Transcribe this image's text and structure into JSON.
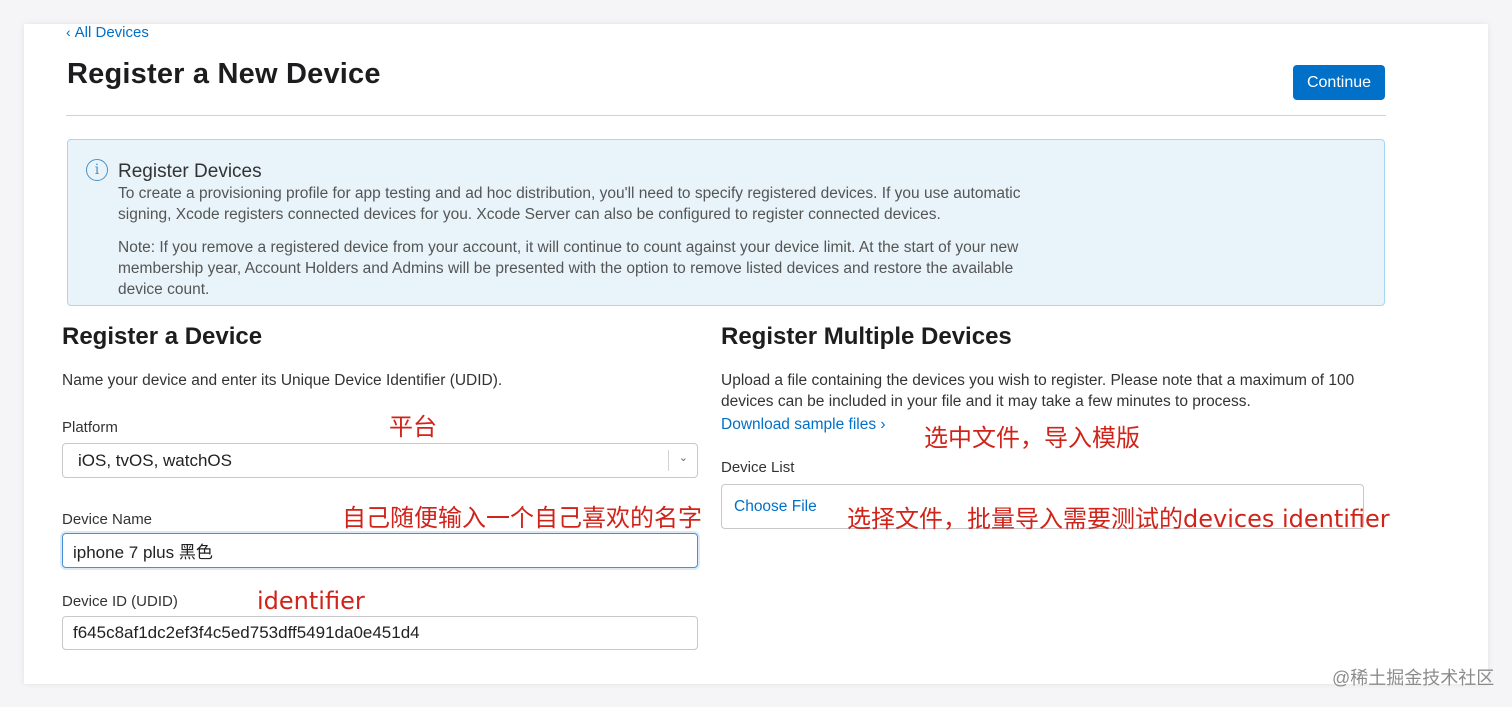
{
  "nav": {
    "back_chevron": "‹",
    "back_label": "All Devices"
  },
  "header": {
    "title": "Register a New Device",
    "continue_label": "Continue"
  },
  "info": {
    "icon": "info-icon",
    "icon_glyph": "i",
    "title": "Register Devices",
    "paragraph1": "To create a provisioning profile for app testing and ad hoc distribution, you'll need to specify registered devices. If you use automatic signing, Xcode registers connected devices for you. Xcode Server can also be configured to register connected devices.",
    "paragraph2": "Note: If you remove a registered device from your account, it will continue to count against your device limit. At the start of your new membership year, Account Holders and Admins will be presented with the option to remove listed devices and restore the available device count."
  },
  "single": {
    "title": "Register a Device",
    "description": "Name your device and enter its Unique Device Identifier (UDID).",
    "platform_label": "Platform",
    "platform_value": "iOS, tvOS, watchOS",
    "name_label": "Device Name",
    "name_value": "iphone 7 plus 黑色",
    "udid_label": "Device ID (UDID)",
    "udid_value": "f645c8af1dc2ef3f4c5ed753dff5491da0e451d4"
  },
  "multiple": {
    "title": "Register Multiple Devices",
    "description": "Upload a file containing the devices you wish to register. Please note that a maximum of 100 devices can be included in your file and it may take a few minutes to process.",
    "download_label": "Download sample files ›",
    "list_label": "Device List",
    "choose_file_label": "Choose File"
  },
  "annotations": {
    "platform": "平台",
    "name": "自己随便输入一个自己喜欢的名字",
    "identifier": "identifier",
    "template": "选中文件，导入模版",
    "batch": "选择文件，批量导入需要测试的devices  identifier"
  },
  "watermark": "@稀土掘金技术社区",
  "colors": {
    "accent": "#0070c9",
    "annotation": "#d0241b",
    "info_bg": "#e8f4fa"
  }
}
